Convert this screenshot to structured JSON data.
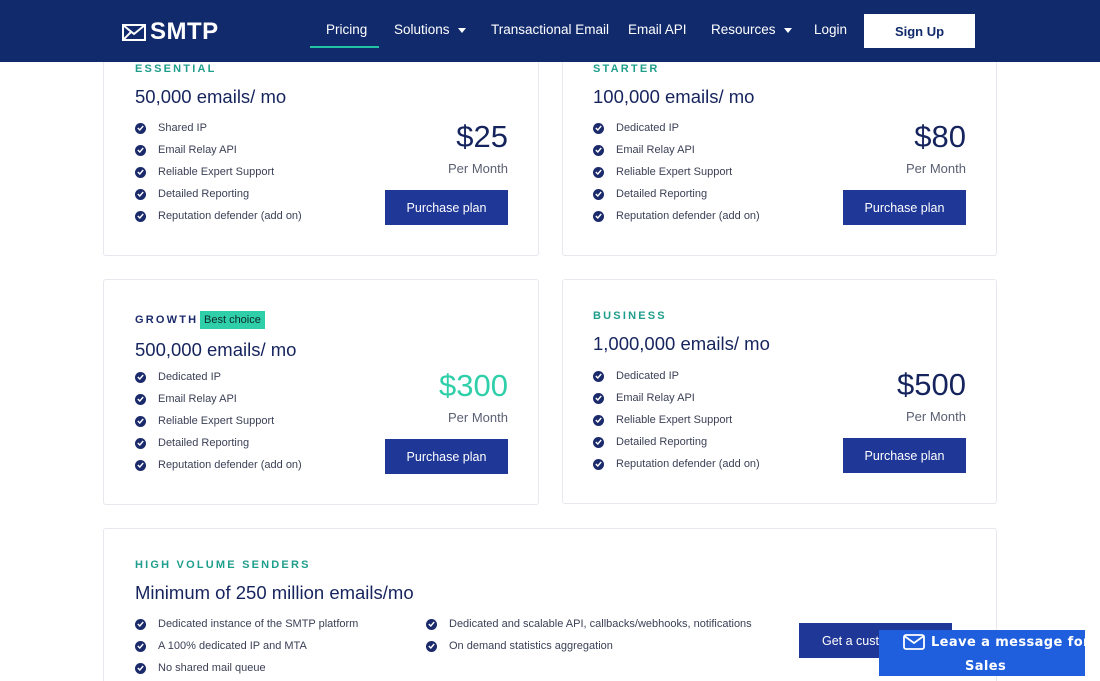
{
  "nav": {
    "logo_text": "SMTP",
    "items": [
      {
        "label": "Pricing"
      },
      {
        "label": "Solutions"
      },
      {
        "label": "Transactional Email"
      },
      {
        "label": "Email API"
      },
      {
        "label": "Resources"
      },
      {
        "label": "Login"
      }
    ],
    "signup_label": "Sign Up"
  },
  "plans": [
    {
      "tier": "ESSENTIAL",
      "volume": "50,000 emails/ mo",
      "price": "$25",
      "period": "Per Month",
      "button": "Purchase plan",
      "features": [
        "Shared IP",
        "Email Relay API",
        "Reliable Expert Support",
        "Detailed Reporting",
        "Reputation defender (add on)"
      ]
    },
    {
      "tier": "STARTER",
      "volume": "100,000 emails/ mo",
      "price": "$80",
      "period": "Per Month",
      "button": "Purchase plan",
      "features": [
        "Dedicated IP",
        "Email Relay API",
        "Reliable Expert Support",
        "Detailed Reporting",
        "Reputation defender (add on)"
      ]
    },
    {
      "tier": "GROWTH",
      "badge": "Best choice",
      "volume": "500,000 emails/ mo",
      "price": "$300",
      "period": "Per Month",
      "button": "Purchase plan",
      "features": [
        "Dedicated IP",
        "Email Relay API",
        "Reliable Expert Support",
        "Detailed Reporting",
        "Reputation defender (add on)"
      ]
    },
    {
      "tier": "BUSINESS",
      "volume": "1,000,000 emails/ mo",
      "price": "$500",
      "period": "Per Month",
      "button": "Purchase plan",
      "features": [
        "Dedicated IP",
        "Email Relay API",
        "Reliable Expert Support",
        "Detailed Reporting",
        "Reputation defender (add on)"
      ]
    }
  ],
  "high_volume": {
    "tier": "HIGH VOLUME SENDERS",
    "volume": "Minimum of 250 million emails/mo",
    "features_left": [
      "Dedicated instance of the SMTP platform",
      "A 100% dedicated IP and MTA",
      "No shared mail queue"
    ],
    "features_right": [
      "Dedicated and scalable API, callbacks/webhooks, notifications",
      "On demand statistics aggregation"
    ],
    "cta_label": "Get a custo"
  },
  "chat": {
    "line1": "Leave a message for",
    "line2": "Sales",
    "icon": "envelope-icon"
  },
  "colors": {
    "nav_bg": "#112a6c",
    "accent_teal": "#2fcfa9",
    "button_blue": "#1f3797",
    "chat_blue": "#1f5fde"
  }
}
